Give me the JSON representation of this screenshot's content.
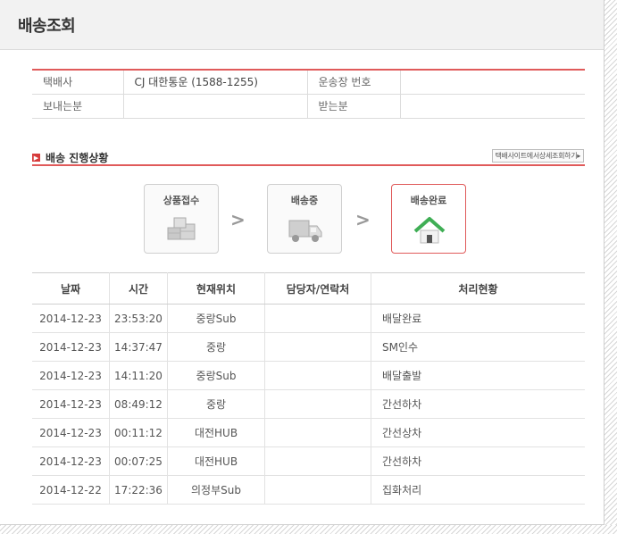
{
  "header": {
    "title": "배송조회"
  },
  "info": {
    "courier_label": "택배사",
    "courier_value": "CJ 대한통운 (1588-1255)",
    "tracking_label": "운송장 번호",
    "tracking_value": "",
    "sender_label": "보내는분",
    "sender_value": "",
    "receiver_label": "받는분",
    "receiver_value": ""
  },
  "progress": {
    "title": "배송 진행상황",
    "detail_link": "택배사이트에서상세조회하기▸",
    "steps": [
      {
        "label": "상품접수",
        "icon": "boxes-icon",
        "active": false
      },
      {
        "label": "배송중",
        "icon": "truck-icon",
        "active": false
      },
      {
        "label": "배송완료",
        "icon": "house-icon",
        "active": true
      }
    ],
    "accent_color": "#e05a5a"
  },
  "table": {
    "headers": [
      "날짜",
      "시간",
      "현재위치",
      "담당자/연락처",
      "처리현황"
    ],
    "rows": [
      [
        "2014-12-23",
        "23:53:20",
        "중랑Sub",
        "",
        "배달완료"
      ],
      [
        "2014-12-23",
        "14:37:47",
        "중랑",
        "",
        "SM인수"
      ],
      [
        "2014-12-23",
        "14:11:20",
        "중랑Sub",
        "",
        "배달출발"
      ],
      [
        "2014-12-23",
        "08:49:12",
        "중랑",
        "",
        "간선하차"
      ],
      [
        "2014-12-23",
        "00:11:12",
        "대전HUB",
        "",
        "간선상차"
      ],
      [
        "2014-12-23",
        "00:07:25",
        "대전HUB",
        "",
        "간선하차"
      ],
      [
        "2014-12-22",
        "17:22:36",
        "의정부Sub",
        "",
        "집화처리"
      ]
    ]
  }
}
